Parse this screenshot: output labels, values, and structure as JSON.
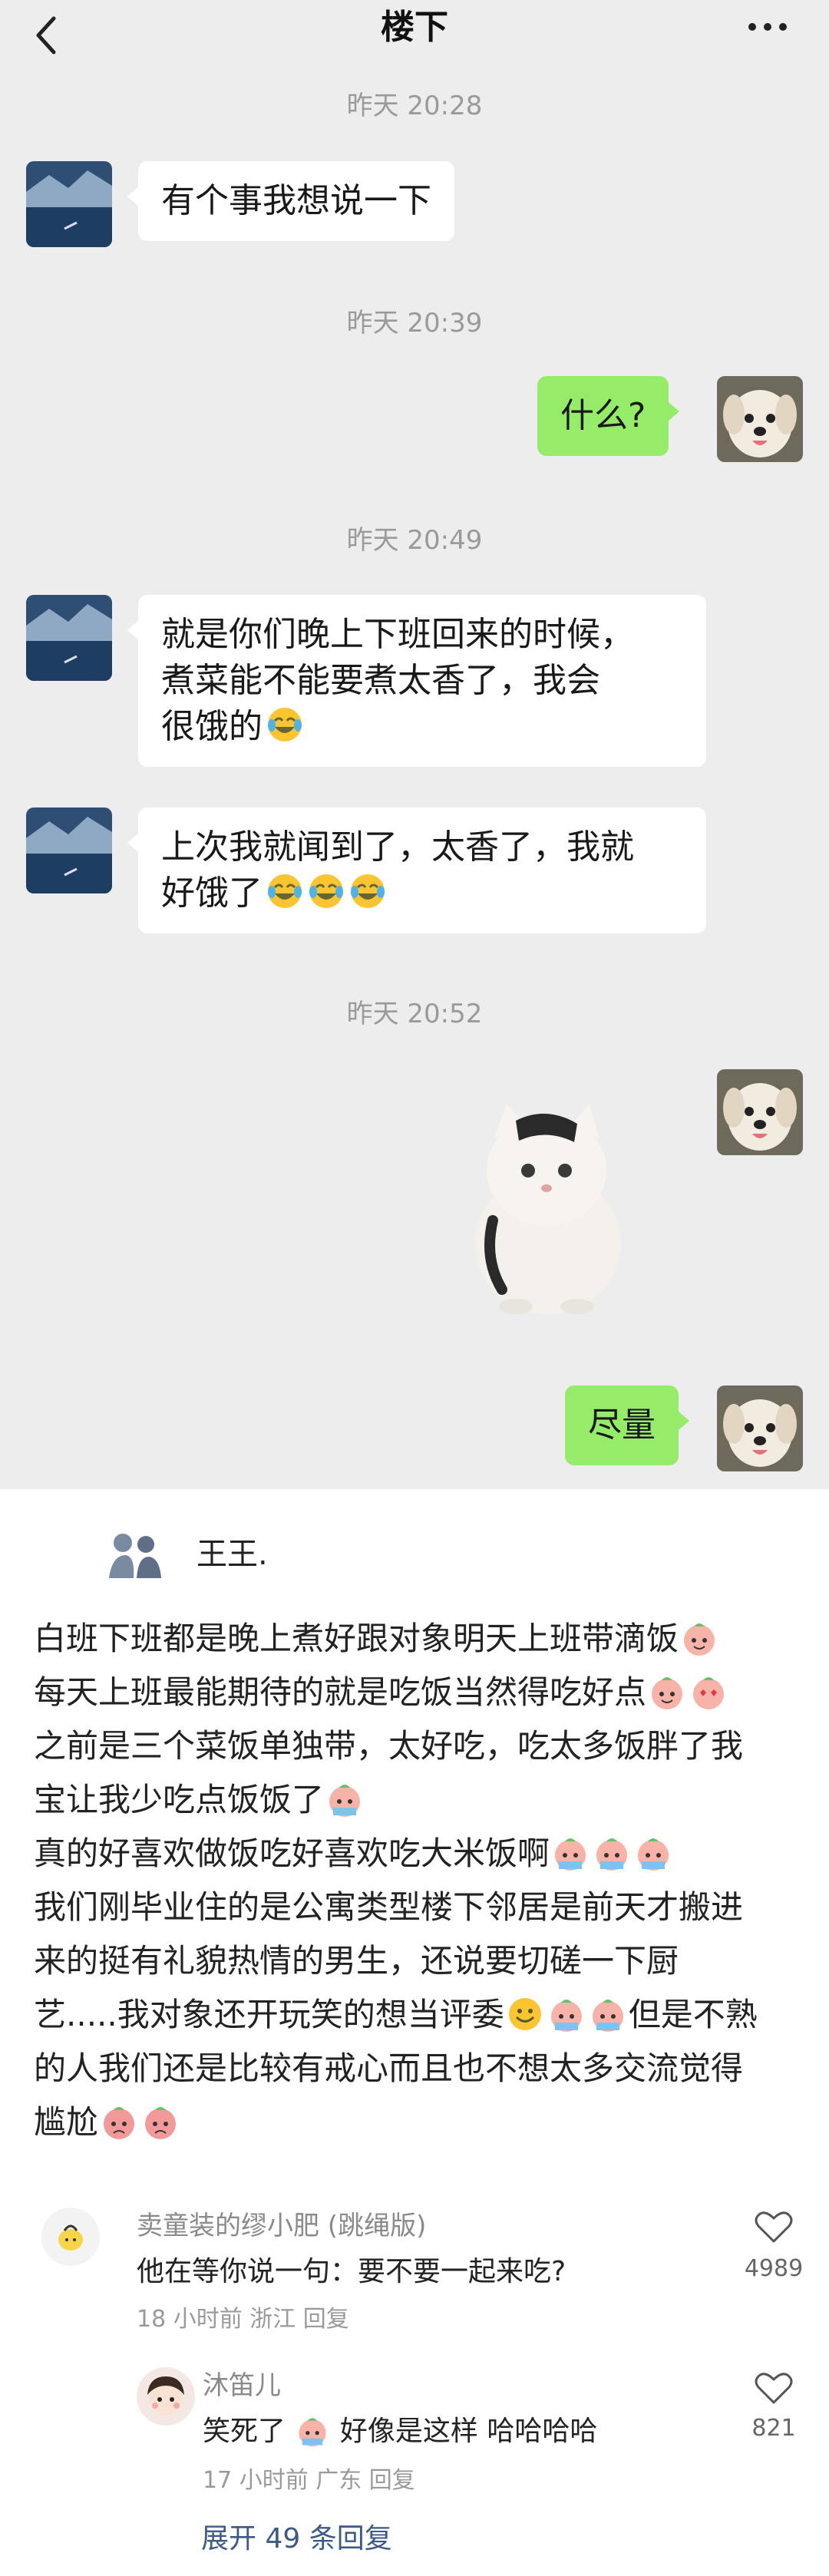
{
  "chat": {
    "title": "楼下",
    "messages": [
      {
        "time": "昨天 20:28"
      },
      {
        "from": "them",
        "text": "有个事我想说一下"
      },
      {
        "time": "昨天 20:39"
      },
      {
        "from": "me",
        "text": "什么?"
      },
      {
        "time": "昨天 20:49"
      },
      {
        "from": "them",
        "lines": [
          "就是你们晚上下班回来的时候，",
          "煮菜能不能要煮太香了，我会",
          "很饿的"
        ],
        "emoji": "laugh-cry"
      },
      {
        "from": "them",
        "lines": [
          "上次我就闻到了，太香了，我就",
          "好饿了"
        ],
        "emoji": "laugh-cry x3"
      },
      {
        "time": "昨天 20:52"
      },
      {
        "from": "me",
        "sticker": "cat-sticker"
      },
      {
        "from": "me",
        "text": "尽量"
      }
    ]
  },
  "post": {
    "author": "王王.",
    "lines": [
      "白班下班都是晚上煮好跟对象明天上班带滴饭",
      "每天上班最能期待的就是吃饭当然得吃好点",
      "之前是三个菜饭单独带，太好吃，吃太多饭胖了我",
      "宝让我少吃点饭饭了",
      "真的好喜欢做饭吃好喜欢吃大米饭啊",
      "我们刚毕业住的是公寓类型楼下邻居是前天才搬进",
      "来的挺有礼貌热情的男生，还说要切磋一下厨",
      "艺.....我对象还开玩笑的想当评委",
      "但是不熟",
      "的人我们还是比较有戒心而且也不想太多交流觉得",
      "尴尬"
    ]
  },
  "comments": [
    {
      "name": "卖童装的缪小肥 (跳绳版)",
      "text": "他在等你说一句：要不要一起来吃?",
      "meta": "18 小时前 浙江 回复",
      "likes": "4989"
    },
    {
      "name": "沐笛儿",
      "text_a": "笑死了",
      "text_b": "好像是这样 哈哈哈哈",
      "meta": "17 小时前 广东 回复",
      "likes": "821"
    }
  ],
  "expand_label": "展开 49 条回复",
  "colors": {
    "chat_bg": "#ededed",
    "my_bubble": "#95ec69",
    "their_bubble": "#ffffff",
    "link": "#3d5a86"
  }
}
